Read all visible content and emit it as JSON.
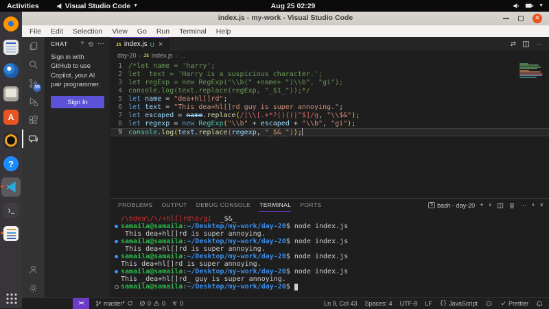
{
  "colors": {
    "accent": "#6c3cc6",
    "button": "#5b52d8",
    "close_btn": "#e9541f",
    "badge": "#3a66c4",
    "untracked": "#73c991",
    "js_icon": "#e8d44d",
    "term_green": "#2ab84a",
    "term_blue": "#3b8eea",
    "term_red": "#cd3131",
    "bullet": "#3794ff"
  },
  "topbar": {
    "activities": "Activities",
    "app_name": "Visual Studio Code",
    "clock": "Aug 25 02:29"
  },
  "dock": {
    "items": [
      "firefox",
      "libreoffice-writer",
      "thunderbird",
      "files",
      "ubuntu-software",
      "rhythmbox",
      "help",
      "vscode",
      "terminal",
      "text-editor"
    ],
    "active": "vscode"
  },
  "window": {
    "title": "index.js - my-work - Visual Studio Code",
    "menu": [
      "File",
      "Edit",
      "Selection",
      "View",
      "Go",
      "Run",
      "Terminal",
      "Help"
    ]
  },
  "activity_bar": {
    "scm_badge": "35"
  },
  "chat": {
    "title": "CHAT",
    "message": "Sign in with GitHub to use Copilot, your AI pair programmer.",
    "sign_in_label": "Sign In"
  },
  "editor": {
    "tab": {
      "file": "index.js",
      "modified": "U"
    },
    "breadcrumbs": [
      "day-20",
      "index.js",
      "..."
    ],
    "active_line": 9,
    "code": [
      {
        "n": 1,
        "tokens": [
          [
            "/*let name = 'harry';",
            "cmt"
          ]
        ]
      },
      {
        "n": 2,
        "tokens": [
          [
            "let  text = 'Harry is a suspicious character.';",
            "cmt"
          ]
        ]
      },
      {
        "n": 3,
        "tokens": [
          [
            "let regExp = new RegExp(\"\\\\b(\" +name+ \")\\\\b\", \"gi\");",
            "cmt"
          ]
        ]
      },
      {
        "n": 4,
        "tokens": [
          [
            "console.log(text.replace(regExp, \"_$1_\"));*/",
            "cmt"
          ]
        ]
      },
      {
        "n": 5,
        "tokens": [
          [
            "let ",
            "kw"
          ],
          [
            "name",
            "vr"
          ],
          [
            " = ",
            "pl"
          ],
          [
            "\"dea+hl[]rd\"",
            "str"
          ],
          [
            ";",
            "pl"
          ]
        ]
      },
      {
        "n": 6,
        "tokens": [
          [
            "let ",
            "kw"
          ],
          [
            "text",
            "vr"
          ],
          [
            " = ",
            "pl"
          ],
          [
            "\"This dea+hl[]rd guy is super annoying.\"",
            "str"
          ],
          [
            ";",
            "pl"
          ]
        ]
      },
      {
        "n": 7,
        "tokens": [
          [
            "let ",
            "kw"
          ],
          [
            "escaped",
            "vr"
          ],
          [
            " = ",
            "pl"
          ],
          [
            "name",
            "vrs"
          ],
          [
            ".",
            "pl"
          ],
          [
            "replace",
            "fn"
          ],
          [
            "(",
            "b1"
          ],
          [
            "/[\\\\[.+*?(){(|^$]/g",
            "rex"
          ],
          [
            ", ",
            "pl"
          ],
          [
            "\"\\\\$&\"",
            "str"
          ],
          [
            ")",
            "b1"
          ],
          [
            ";",
            "pl"
          ]
        ]
      },
      {
        "n": 8,
        "tokens": [
          [
            "let ",
            "kw"
          ],
          [
            "regexp",
            "vr"
          ],
          [
            " = ",
            "pl"
          ],
          [
            "new ",
            "kw"
          ],
          [
            "RegExp",
            "cls"
          ],
          [
            "(",
            "b1"
          ],
          [
            "\"\\\\b\"",
            "str"
          ],
          [
            " + ",
            "pl"
          ],
          [
            "escaped",
            "vr"
          ],
          [
            " + ",
            "pl"
          ],
          [
            "\"\\\\b\"",
            "str"
          ],
          [
            ", ",
            "pl"
          ],
          [
            "\"gi\"",
            "str"
          ],
          [
            ")",
            "b1"
          ],
          [
            ";",
            "pl"
          ]
        ]
      },
      {
        "n": 9,
        "caret": true,
        "tokens": [
          [
            "console",
            "cls"
          ],
          [
            ".",
            "pl"
          ],
          [
            "log",
            "fn"
          ],
          [
            "(",
            "b1"
          ],
          [
            "text",
            "vr"
          ],
          [
            ".",
            "pl"
          ],
          [
            "replace",
            "fn"
          ],
          [
            "(",
            "b2"
          ],
          [
            "regexp",
            "vr"
          ],
          [
            ", ",
            "pl"
          ],
          [
            "\"_$&_\"",
            "str"
          ],
          [
            ")",
            "b2"
          ],
          [
            ")",
            "b1"
          ],
          [
            ";",
            "pl"
          ]
        ]
      }
    ]
  },
  "panel": {
    "tabs": [
      "PROBLEMS",
      "OUTPUT",
      "DEBUG CONSOLE",
      "TERMINAL",
      "PORTS"
    ],
    "active_tab": "TERMINAL",
    "shell": "bash - day-20",
    "terminal": [
      {
        "dot": "none",
        "segs": [
          [
            "/\\bdea\\/\\/+hl[]rd\\b/gi",
            "red"
          ],
          [
            "  _$&_",
            "wt"
          ]
        ]
      },
      {
        "dot": "filled",
        "segs": [
          [
            "samaila@samaila",
            "gr"
          ],
          [
            ":",
            "wt"
          ],
          [
            "~/Desktop/my-work/day-20",
            "bl"
          ],
          [
            "$ node index.js",
            "wt"
          ]
        ]
      },
      {
        "dot": "none",
        "segs": [
          [
            " This dea+hl[]rd is super annoying.",
            "wt"
          ]
        ]
      },
      {
        "dot": "filled",
        "segs": [
          [
            "samaila@samaila",
            "gr"
          ],
          [
            ":",
            "wt"
          ],
          [
            "~/Desktop/my-work/day-20",
            "bl"
          ],
          [
            "$ node index.js",
            "wt"
          ]
        ]
      },
      {
        "dot": "none",
        "segs": [
          [
            " This dea+hl[]rd is super annoying.",
            "wt"
          ]
        ]
      },
      {
        "dot": "filled",
        "segs": [
          [
            "samaila@samaila",
            "gr"
          ],
          [
            ":",
            "wt"
          ],
          [
            "~/Desktop/my-work/day-20",
            "bl"
          ],
          [
            "$ node index.js",
            "wt"
          ]
        ]
      },
      {
        "dot": "none",
        "segs": [
          [
            "This dea+hl[]rd is super annoying.",
            "wt"
          ]
        ]
      },
      {
        "dot": "filled",
        "segs": [
          [
            "samaila@samaila",
            "gr"
          ],
          [
            ":",
            "wt"
          ],
          [
            "~/Desktop/my-work/day-20",
            "bl"
          ],
          [
            "$ node index.js",
            "wt"
          ]
        ]
      },
      {
        "dot": "none",
        "segs": [
          [
            "This _dea+hl[]rd_ guy is super annoying.",
            "wt"
          ]
        ]
      },
      {
        "dot": "hollow",
        "segs": [
          [
            "samaila@samaila",
            "gr"
          ],
          [
            ":",
            "wt"
          ],
          [
            "~/Desktop/my-work/day-20",
            "bl"
          ],
          [
            "$ ",
            "wt"
          ],
          [
            " ",
            "cur"
          ]
        ]
      }
    ]
  },
  "status_bar": {
    "branch": "master*",
    "errors": "0",
    "warnings": "0",
    "ports": "0",
    "line_col": "Ln 9, Col 43",
    "indent": "Spaces: 4",
    "encoding": "UTF-8",
    "eol": "LF",
    "language": "JavaScript",
    "formatter": "Prettier"
  }
}
